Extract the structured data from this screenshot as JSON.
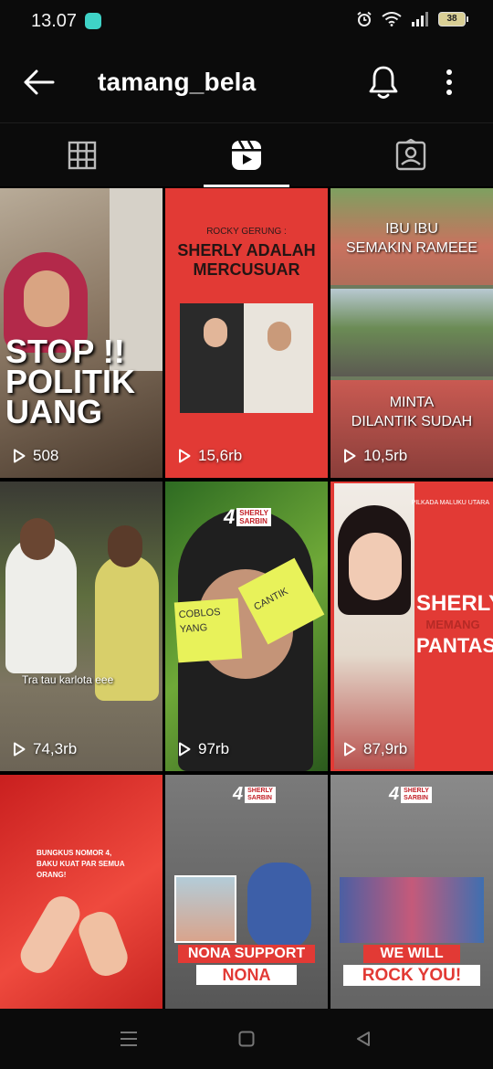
{
  "status": {
    "time": "13.07",
    "battery": "38"
  },
  "header": {
    "username": "tamang_bela"
  },
  "tabs": [
    {
      "name": "posts",
      "active": false
    },
    {
      "name": "reels",
      "active": true
    },
    {
      "name": "tagged",
      "active": false
    }
  ],
  "reels": [
    {
      "views": "508",
      "overlay": [
        "STOP !!",
        "POLITIK",
        "UANG"
      ]
    },
    {
      "views": "15,6rb",
      "kicker": "ROCKY GERUNG :",
      "headline": [
        "SHERLY ADALAH",
        "MERCUSUAR"
      ]
    },
    {
      "views": "10,5rb",
      "top_caption": [
        "IBU IBU",
        "SEMAKIN RAMEEE"
      ],
      "bottom_caption": [
        "MINTA",
        "DILANTIK SUDAH"
      ]
    },
    {
      "views": "74,3rb",
      "caption": "Tra tau karlota eee"
    },
    {
      "views": "97rb",
      "badge_number": "4",
      "badge_text": [
        "SHERLY",
        "SARBIN"
      ],
      "notes": [
        "COBLOS",
        "YANG",
        "CANTIK"
      ]
    },
    {
      "views": "87,9rb",
      "kicker": "PILKADA MALUKU UTARA",
      "headline": [
        "SHERLY",
        "MEMANG",
        "PANTAS"
      ]
    },
    {
      "views": "",
      "caption": [
        "BUNGKUS NOMOR 4,",
        "BAKU KUAT PAR SEMUA",
        "ORANG!"
      ]
    },
    {
      "views": "",
      "badge_number": "4",
      "badge_text": [
        "SHERLY",
        "SARBIN"
      ],
      "banner": [
        "NONA SUPPORT",
        "NONA"
      ]
    },
    {
      "views": "",
      "badge_number": "4",
      "badge_text": [
        "SHERLY",
        "SARBIN"
      ],
      "banner": [
        "WE WILL",
        "ROCK YOU!"
      ]
    }
  ],
  "colors": {
    "background": "#0b0b0b",
    "campaign_red": "#e23a35",
    "note_yellow": "#e8f25a"
  }
}
